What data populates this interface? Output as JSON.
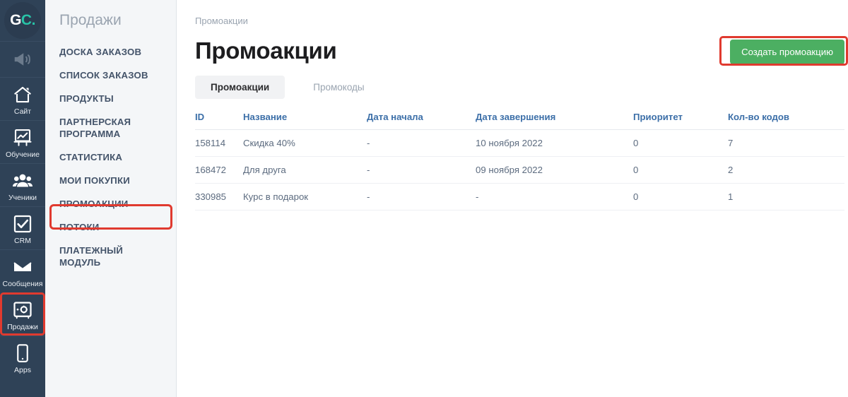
{
  "rail": {
    "logo": {
      "part1": "G",
      "part2": "C."
    },
    "items": [
      {
        "name": "megaphone-icon",
        "label": "",
        "icon": "megaphone",
        "dim": true,
        "highlight": false
      },
      {
        "name": "site",
        "label": "Сайт",
        "icon": "home",
        "dim": false,
        "highlight": false
      },
      {
        "name": "training",
        "label": "Обучение",
        "icon": "chart-board",
        "dim": false,
        "highlight": false
      },
      {
        "name": "students",
        "label": "Ученики",
        "icon": "people",
        "dim": false,
        "highlight": false
      },
      {
        "name": "crm",
        "label": "CRM",
        "icon": "check-square",
        "dim": false,
        "highlight": false
      },
      {
        "name": "messages",
        "label": "Сообщения",
        "icon": "envelope",
        "dim": false,
        "highlight": false
      },
      {
        "name": "sales",
        "label": "Продажи",
        "icon": "safe",
        "dim": false,
        "highlight": true
      },
      {
        "name": "apps",
        "label": "Apps",
        "icon": "phone",
        "dim": false,
        "highlight": false
      }
    ]
  },
  "subnav": {
    "title": "Продажи",
    "items": [
      {
        "label": "ДОСКА ЗАКАЗОВ",
        "active": false
      },
      {
        "label": "СПИСОК ЗАКАЗОВ",
        "active": false
      },
      {
        "label": "ПРОДУКТЫ",
        "active": false
      },
      {
        "label": "ПАРТНЕРСКАЯ ПРОГРАММА",
        "active": false
      },
      {
        "label": "СТАТИСТИКА",
        "active": false
      },
      {
        "label": "МОИ ПОКУПКИ",
        "active": false
      },
      {
        "label": "ПРОМОАКЦИИ",
        "active": true
      },
      {
        "label": "ПОТОКИ",
        "active": false
      },
      {
        "label": "ПЛАТЕЖНЫЙ МОДУЛЬ",
        "active": false
      }
    ]
  },
  "main": {
    "breadcrumb": "Промоакции",
    "page_title": "Промоакции",
    "create_button": "Создать промоакцию",
    "tabs": [
      {
        "label": "Промоакции",
        "active": true
      },
      {
        "label": "Промокоды",
        "active": false
      }
    ],
    "table": {
      "headers": [
        "ID",
        "Название",
        "Дата начала",
        "Дата завершения",
        "Приоритет",
        "Кол-во кодов"
      ],
      "rows": [
        {
          "id": "158114",
          "name": "Скидка 40%",
          "start": "-",
          "end": "10 ноября 2022",
          "priority": "0",
          "codes": "7"
        },
        {
          "id": "168472",
          "name": "Для друга",
          "start": "-",
          "end": "09 ноября 2022",
          "priority": "0",
          "codes": "2"
        },
        {
          "id": "330985",
          "name": "Курс в подарок",
          "start": "-",
          "end": "-",
          "priority": "0",
          "codes": "1"
        }
      ]
    }
  },
  "colors": {
    "rail_bg": "#2f4257",
    "subnav_bg": "#f4f6f8",
    "accent_green": "#4caf62",
    "highlight_red": "#e03a2f",
    "link_blue": "#5d87b5",
    "header_blue": "#3c6fa8",
    "logo_teal": "#28c3a7"
  }
}
